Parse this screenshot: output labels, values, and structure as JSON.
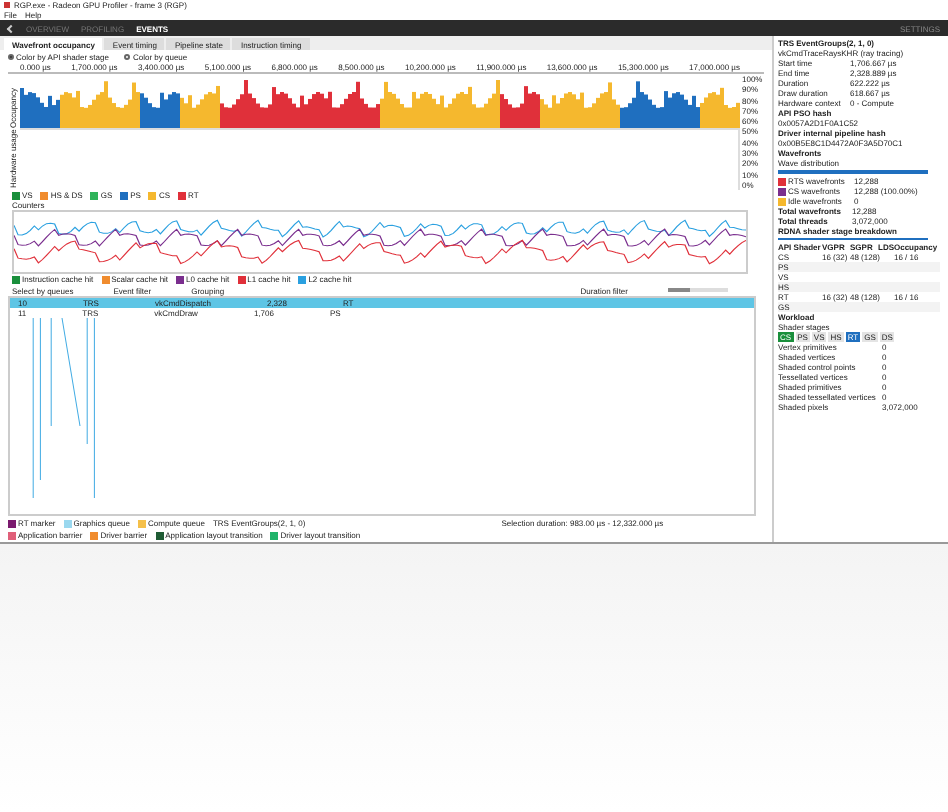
{
  "window": {
    "title": "RGP.exe - Radeon GPU Profiler - frame 3 (RGP)"
  },
  "menu": [
    "File",
    "Help"
  ],
  "nav": [
    {
      "label": "OVERVIEW",
      "selected": false
    },
    {
      "label": "PROFILING",
      "selected": false
    },
    {
      "label": "EVENTS",
      "selected": true
    }
  ],
  "nav_right": "SETTINGS",
  "tabs": [
    {
      "label": "Wavefront occupancy",
      "selected": true
    },
    {
      "label": "Event timing",
      "selected": false
    },
    {
      "label": "Pipeline state",
      "selected": false
    },
    {
      "label": "Instruction timing",
      "selected": false
    }
  ],
  "options": [
    {
      "label": "Color by API shader stage",
      "selected": true
    },
    {
      "label": "Color by queue",
      "selected": false
    }
  ],
  "ruler": [
    "0.000 µs",
    "1,700.000 µs",
    "3,400.000 µs",
    "5,100.000 µs",
    "6,800.000 µs",
    "8,500.000 µs",
    "10,200.000 µs",
    "11,900.000 µs",
    "13,600.000 µs",
    "15,300.000 µs",
    "17,000.000 µs"
  ],
  "axis": [
    "100%",
    "90%",
    "80%",
    "70%",
    "60%",
    "50%",
    "40%",
    "30%",
    "20%",
    "10%",
    "0%"
  ],
  "side_labels": [
    "Occupancy",
    "Hardware usage"
  ],
  "stage_legend": [
    {
      "label": "VS",
      "color": "#1a8f3c"
    },
    {
      "label": "HS & DS",
      "color": "#f08c2e"
    },
    {
      "label": "GS",
      "color": "#2fb35a"
    },
    {
      "label": "PS",
      "color": "#1f6fbf"
    },
    {
      "label": "CS",
      "color": "#f5b82e"
    },
    {
      "label": "RT",
      "color": "#e0303a"
    }
  ],
  "counters_label": "Counters",
  "line_legend": [
    {
      "label": "Instruction cache hit",
      "color": "#1a8f3c"
    },
    {
      "label": "Scalar cache hit",
      "color": "#f08c2e"
    },
    {
      "label": "L0 cache hit",
      "color": "#7a2e8e"
    },
    {
      "label": "L1 cache hit",
      "color": "#e0303a"
    },
    {
      "label": "L2 cache hit",
      "color": "#2aa0e0"
    }
  ],
  "table_controls": [
    "Select by queues",
    "Event filter",
    "Grouping"
  ],
  "duration_filter": "Duration filter",
  "duration_slider": {
    "level": 0.35
  },
  "rows": [
    {
      "cells": [
        "10",
        "TRS",
        "vkCmdDispatch",
        "2,328",
        "RT"
      ],
      "selected": true
    },
    {
      "cells": [
        "11",
        "TRS",
        "vkCmdDraw",
        "1,706",
        "PS"
      ],
      "selected": false
    }
  ],
  "details": {
    "title": "TRS EventGroups(2, 1, 0)",
    "subtitle": "vkCmdTraceRaysKHR (ray tracing)",
    "fields": [
      {
        "label": "Start time",
        "value": "1,706.667 µs"
      },
      {
        "label": "End time",
        "value": "2,328.889 µs"
      },
      {
        "label": "Duration",
        "value": "622.222 µs"
      },
      {
        "label": "Draw duration",
        "value": "618.667 µs"
      },
      {
        "label": "Hardware context",
        "value": "0 - Compute"
      }
    ],
    "api_pso": "API PSO hash",
    "api_pso_value": "0x0057A2D1F0A1C52",
    "pipeline": "Driver internal pipeline hash",
    "pipeline_value": "0x00B5E8C1D4472A0F3A5D70C1",
    "wavefronts": "Wavefronts",
    "distribution": "Wave distribution",
    "waves": [
      {
        "label": "RTS wavefronts",
        "value": "12,288",
        "color": "#e0303a"
      },
      {
        "label": "CS wavefronts",
        "value": "12,288 (100.00%)",
        "color": "#7a2e8e"
      },
      {
        "label": "Idle wavefronts",
        "value": "0",
        "color": "#f5b82e"
      }
    ],
    "totals": [
      {
        "label": "Total wavefronts",
        "value": "12,288"
      },
      {
        "label": "Total threads",
        "value": "3,072,000"
      }
    ],
    "stage_title": "RDNA shader stage breakdown",
    "stage_cols": [
      "API Shader",
      "VGPR",
      "SGPR",
      "LDS",
      "Occupancy"
    ],
    "stage_rows": [
      [
        "CS",
        "16 (32)",
        "48 (128)",
        "",
        "16 / 16"
      ],
      [
        "PS",
        "",
        "",
        "",
        ""
      ],
      [
        "VS",
        "",
        "",
        "",
        ""
      ],
      [
        "HS",
        "",
        "",
        "",
        ""
      ],
      [
        "RT",
        "16 (32)",
        "48 (128)",
        "",
        "16 / 16"
      ],
      [
        "GS",
        "",
        "",
        "",
        ""
      ]
    ],
    "workload": "Workload",
    "shader_stages": "Shader stages",
    "stage_buttons": [
      {
        "label": "CS",
        "selected": true
      },
      {
        "label": "PS",
        "selected": false
      },
      {
        "label": "VS",
        "selected": false
      },
      {
        "label": "HS",
        "selected": false
      },
      {
        "label": "RT",
        "selected": true
      },
      {
        "label": "GS",
        "selected": false
      },
      {
        "label": "DS",
        "selected": false
      }
    ],
    "work": [
      {
        "label": "Vertex primitives",
        "value": "0"
      },
      {
        "label": "Shaded vertices",
        "value": "0"
      },
      {
        "label": "Shaded control points",
        "value": "0"
      },
      {
        "label": "Tessellated vertices",
        "value": "0"
      },
      {
        "label": "Shaded primitives",
        "value": "0"
      },
      {
        "label": "Shaded tessellated vertices",
        "value": "0"
      },
      {
        "label": "Shaded pixels",
        "value": "3,072,000"
      }
    ]
  },
  "bottom_legend": [
    {
      "label": "RT marker",
      "color": "#7a1a6e"
    },
    {
      "label": "Graphics queue",
      "color": "#9ad8ef"
    },
    {
      "label": "Compute queue",
      "color": "#f5c04a"
    },
    {
      "label": "Application barrier",
      "color": "#e0607a"
    },
    {
      "label": "Driver barrier",
      "color": "#f08c2e"
    },
    {
      "label": "Application layout transition",
      "color": "#1f5c34"
    },
    {
      "label": "Driver layout transition",
      "color": "#21b36a"
    }
  ],
  "selection_event": "TRS EventGroups(2, 1, 0)",
  "selection": "Selection duration: 983.00 µs - 12,332.000 µs"
}
